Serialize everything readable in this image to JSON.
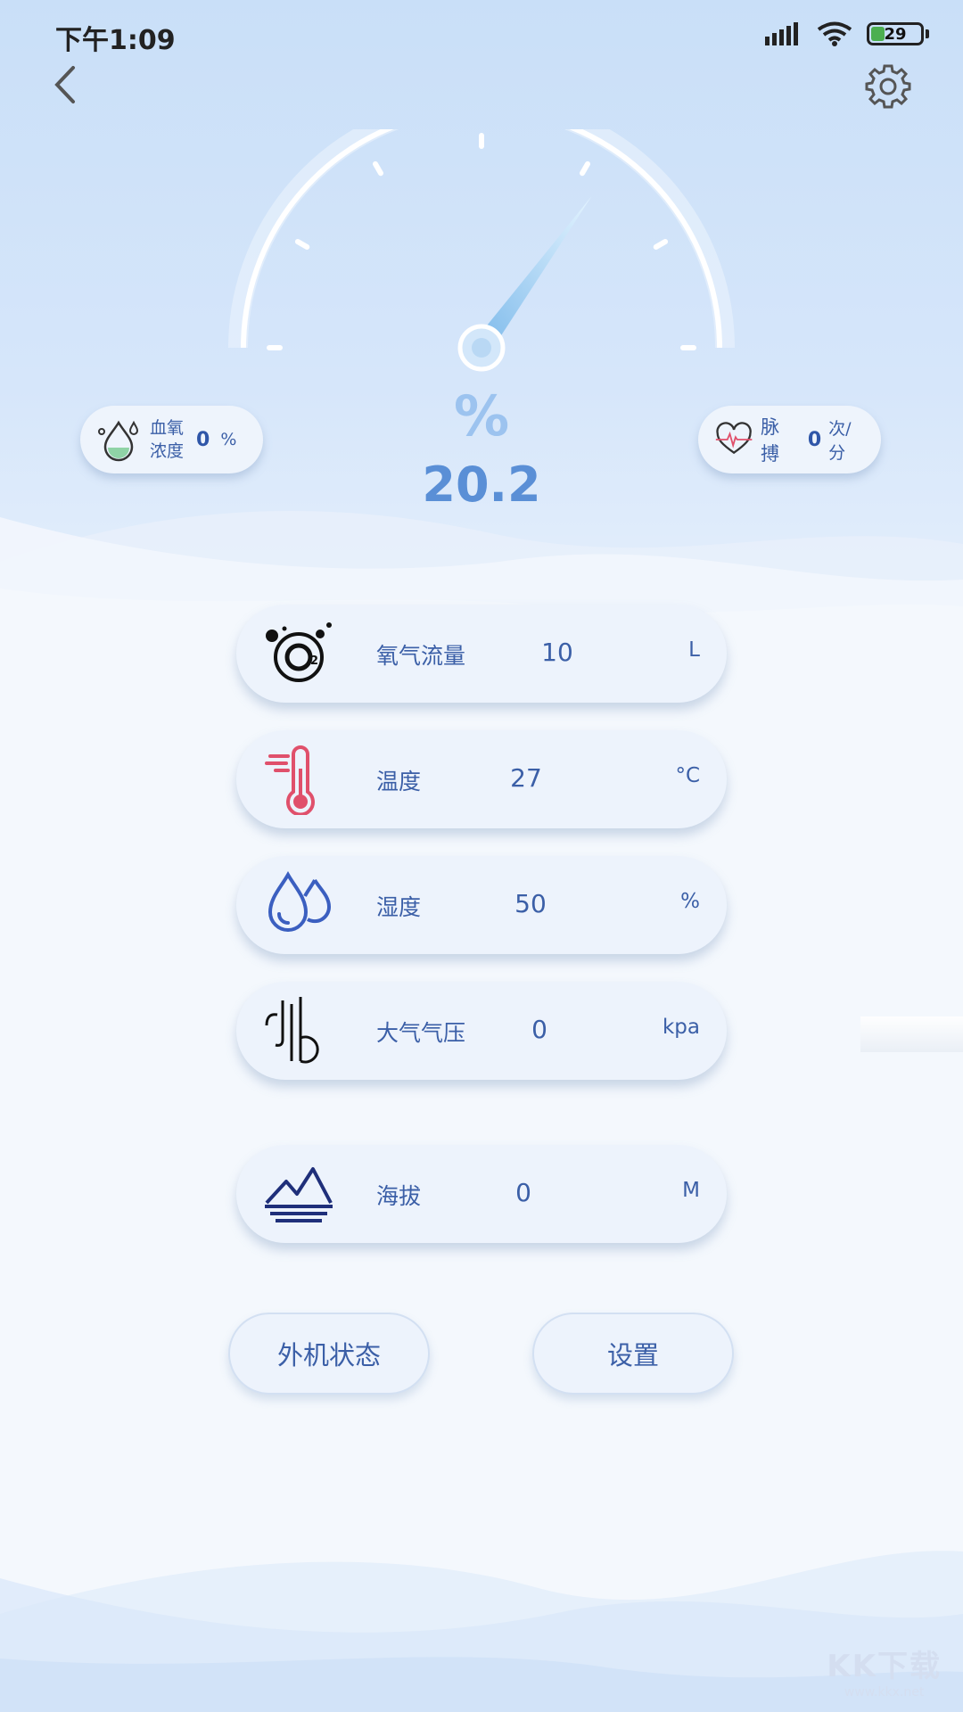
{
  "status_bar": {
    "time": "下午1:09",
    "battery": "29",
    "battery_level": 0.29
  },
  "header": {
    "back_icon": "chevron-left-icon",
    "settings_icon": "gear-icon"
  },
  "gauge": {
    "unit": "%",
    "value": "20.2",
    "fraction": 0.7
  },
  "blood_oxygen": {
    "label_line1": "血氧",
    "label_line2": "浓度",
    "value": "0",
    "unit": "%"
  },
  "pulse": {
    "label": "脉搏",
    "value": "0",
    "unit": "次/分"
  },
  "metrics": [
    {
      "label": "氧气流量",
      "value": "10",
      "unit": "L",
      "icon": "o2-icon",
      "color": "#111111"
    },
    {
      "label": "温度",
      "value": "27",
      "unit": "°C",
      "icon": "thermometer-icon",
      "color": "#e0506b"
    },
    {
      "label": "湿度",
      "value": "50",
      "unit": "%",
      "icon": "water-drops-icon",
      "color": "#3b5fc0"
    },
    {
      "label": "大气气压",
      "value": "0",
      "unit": "kpa",
      "icon": "pressure-icon",
      "color": "#111111"
    },
    {
      "label": "海拔",
      "value": "0",
      "unit": "M",
      "icon": "mountain-icon",
      "color": "#1f2f7a"
    }
  ],
  "buttons": {
    "external_status": "外机状态",
    "settings": "设置"
  },
  "watermark": {
    "line1": "KK下载",
    "line2": "www.kkx.net"
  },
  "colors": {
    "accent": "#5a8fd6",
    "text": "#3b5fa7"
  }
}
